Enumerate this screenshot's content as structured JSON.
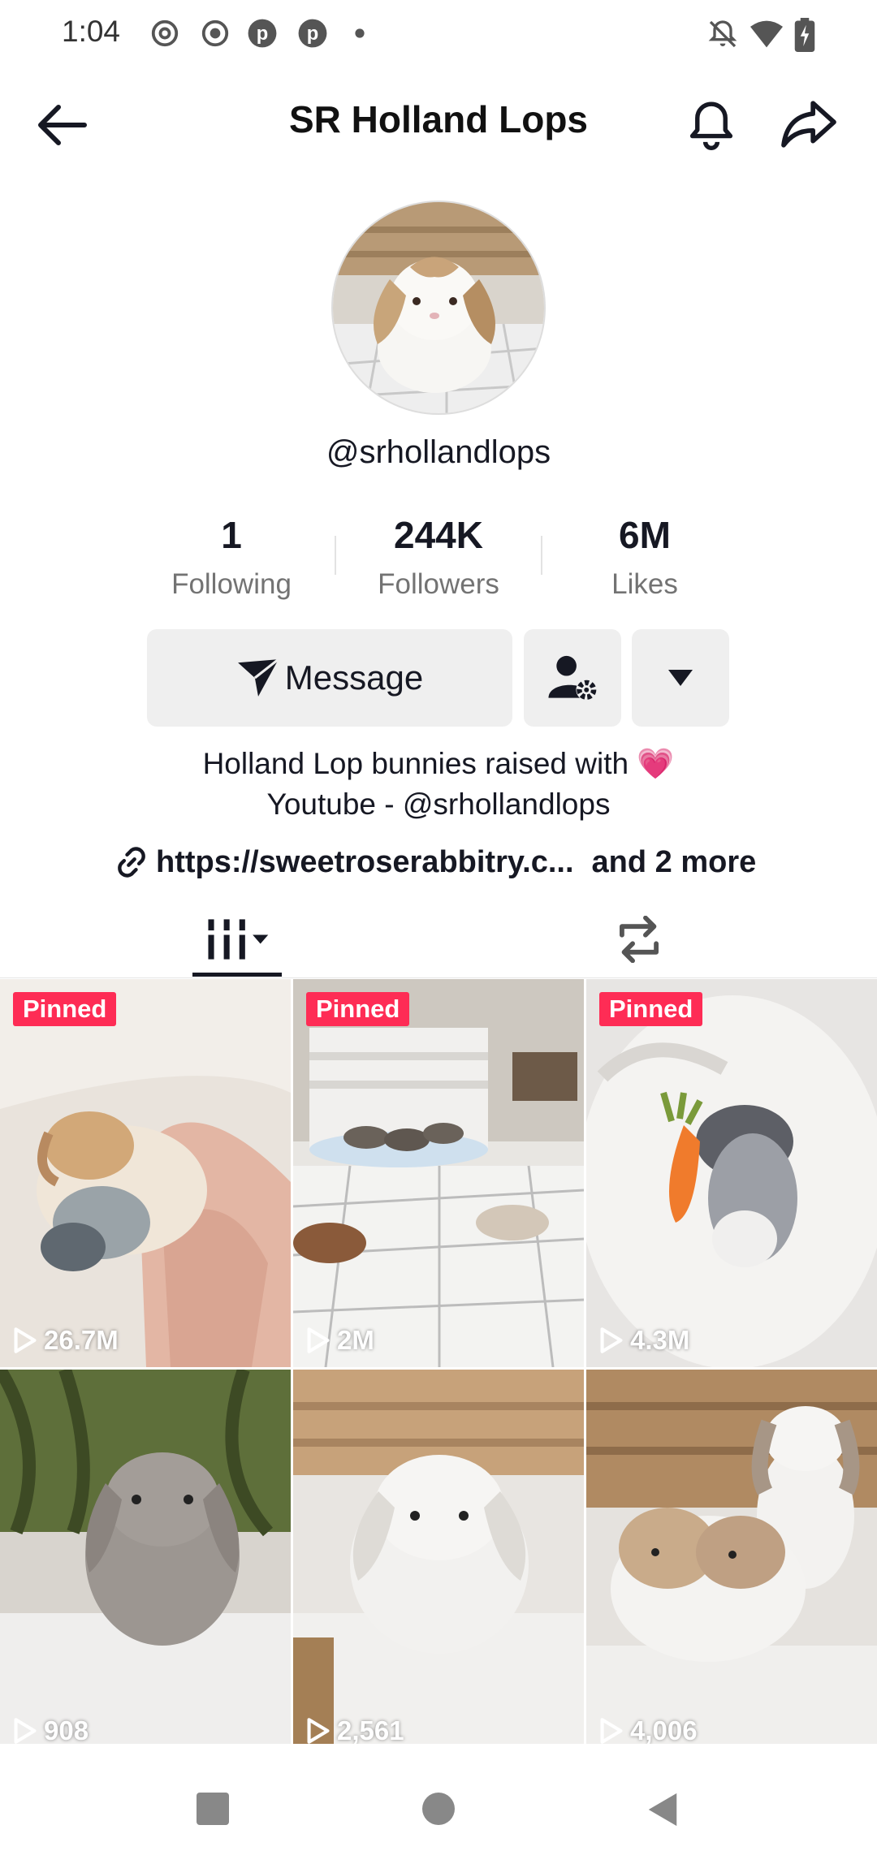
{
  "status_bar": {
    "time": "1:04",
    "left_icons": [
      "threads-icon",
      "record-icon",
      "pinterest-icon",
      "pinterest-icon",
      "dot-icon"
    ],
    "right_icons": [
      "bell-muted-icon",
      "wifi-icon",
      "battery-charging-icon"
    ]
  },
  "header": {
    "title": "SR Holland Lops",
    "back_icon": "back-arrow-icon",
    "bell_icon": "bell-icon",
    "share_icon": "share-icon"
  },
  "profile": {
    "handle": "@srhollandlops",
    "stats": [
      {
        "value": "1",
        "label": "Following"
      },
      {
        "value": "244K",
        "label": "Followers"
      },
      {
        "value": "6M",
        "label": "Likes"
      }
    ],
    "message_button": "Message",
    "bio_line1": "Holland Lop bunnies raised with 💗",
    "bio_line2": "Youtube - @srhollandlops",
    "link_text": "https://sweetroserabbitry.c...",
    "link_more": "and 2 more"
  },
  "tabs": [
    "videos-grid-tab",
    "reposts-tab"
  ],
  "videos": [
    {
      "pinned": "Pinned",
      "views": "26.7M"
    },
    {
      "pinned": "Pinned",
      "views": "2M"
    },
    {
      "pinned": "Pinned",
      "views": "4.3M"
    },
    {
      "pinned": "",
      "views": "908"
    },
    {
      "pinned": "",
      "views": "2,561"
    },
    {
      "pinned": "",
      "views": "4,006"
    }
  ],
  "colors": {
    "accent": "#fe2c55",
    "button_bg": "#efefef",
    "muted_text": "#737373"
  }
}
